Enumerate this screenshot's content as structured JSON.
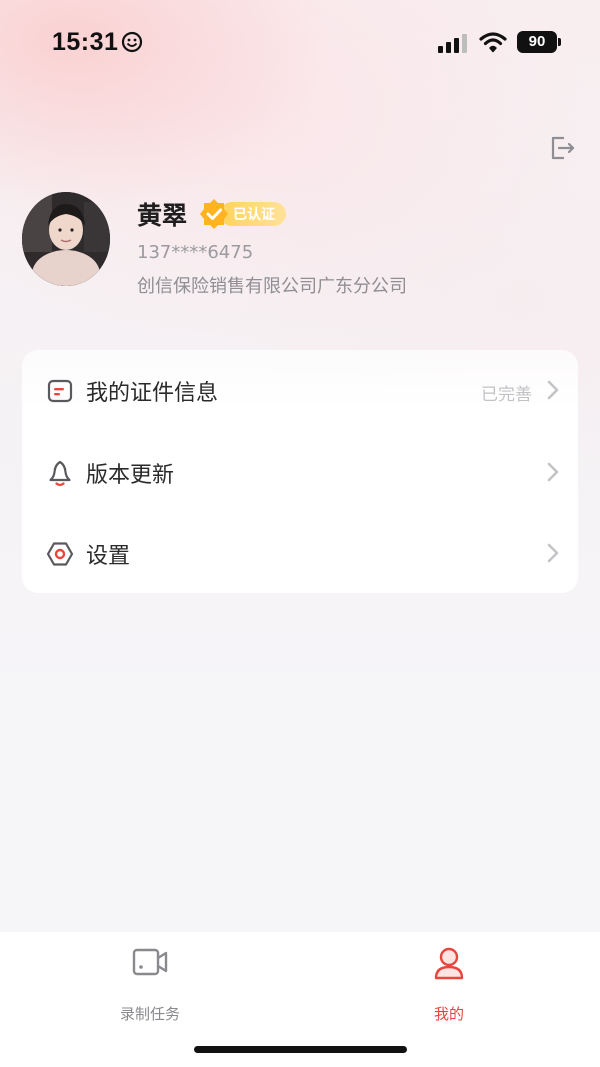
{
  "status_bar": {
    "time": "15:31",
    "battery": "90"
  },
  "header": {
    "logout_icon": "logout-icon"
  },
  "profile": {
    "name": "黄翠",
    "certified_label": "已认证",
    "phone": "137****6475",
    "company": "创信保险销售有限公司广东分公司"
  },
  "menu": {
    "items": [
      {
        "label": "我的证件信息",
        "status": "已完善",
        "icon": "id-card-icon"
      },
      {
        "label": "版本更新",
        "status": "",
        "icon": "bell-icon"
      },
      {
        "label": "设置",
        "status": "",
        "icon": "settings-icon"
      }
    ]
  },
  "tabbar": {
    "tabs": [
      {
        "label": "录制任务",
        "icon": "video-camera-icon",
        "active": false
      },
      {
        "label": "我的",
        "icon": "user-icon",
        "active": true
      }
    ]
  },
  "colors": {
    "accent": "#e8463d",
    "badge": "#ffc93a",
    "inactive_tab": "#8a8a8e"
  }
}
